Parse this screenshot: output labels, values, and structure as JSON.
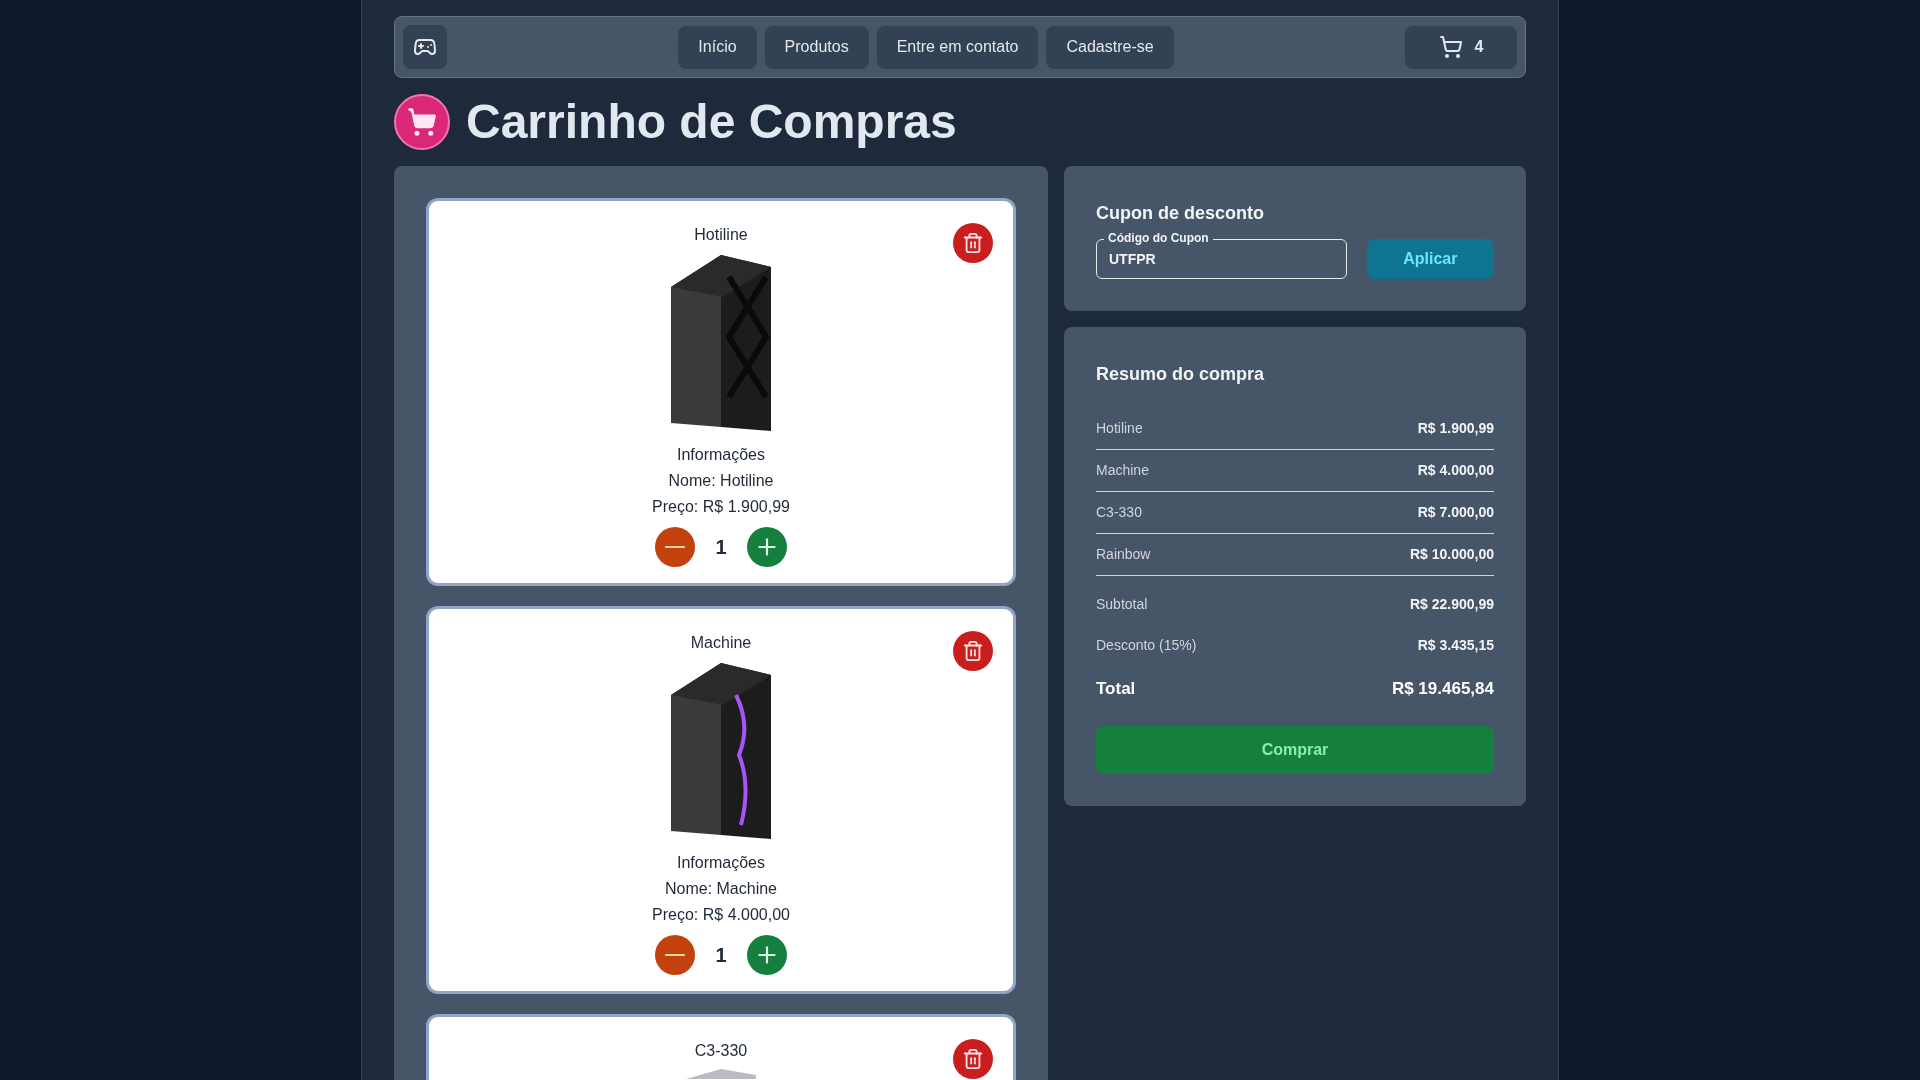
{
  "nav": {
    "links": [
      {
        "label": "Início"
      },
      {
        "label": "Produtos"
      },
      {
        "label": "Entre em contato"
      },
      {
        "label": "Cadastre-se"
      }
    ],
    "cart_count": "4"
  },
  "title": "Carrinho de Compras",
  "cart_items": [
    {
      "name": "Hotiline",
      "info_heading": "Informações",
      "name_line": "Nome: Hotiline",
      "price_line": "Preço: R$ 1.900,99",
      "quantity": "1"
    },
    {
      "name": "Machine",
      "info_heading": "Informações",
      "name_line": "Nome: Machine",
      "price_line": "Preço: R$ 4.000,00",
      "quantity": "1"
    },
    {
      "name": "C3-330"
    }
  ],
  "coupon": {
    "heading": "Cupon de desconto",
    "field_label": "Código do Cupon",
    "value": "UTFPR",
    "button": "Aplicar"
  },
  "summary": {
    "heading": "Resumo do compra",
    "items": [
      {
        "label": "Hotiline",
        "value": "R$ 1.900,99"
      },
      {
        "label": "Machine",
        "value": "R$ 4.000,00"
      },
      {
        "label": "C3-330",
        "value": "R$ 7.000,00"
      },
      {
        "label": "Rainbow",
        "value": "R$ 10.000,00"
      }
    ],
    "subtotal": {
      "label": "Subtotal",
      "value": "R$ 22.900,99"
    },
    "discount": {
      "label": "Desconto (15%)",
      "value": "R$ 3.435,15"
    },
    "total": {
      "label": "Total",
      "value": "R$ 19.465,84"
    },
    "button": "Comprar"
  }
}
